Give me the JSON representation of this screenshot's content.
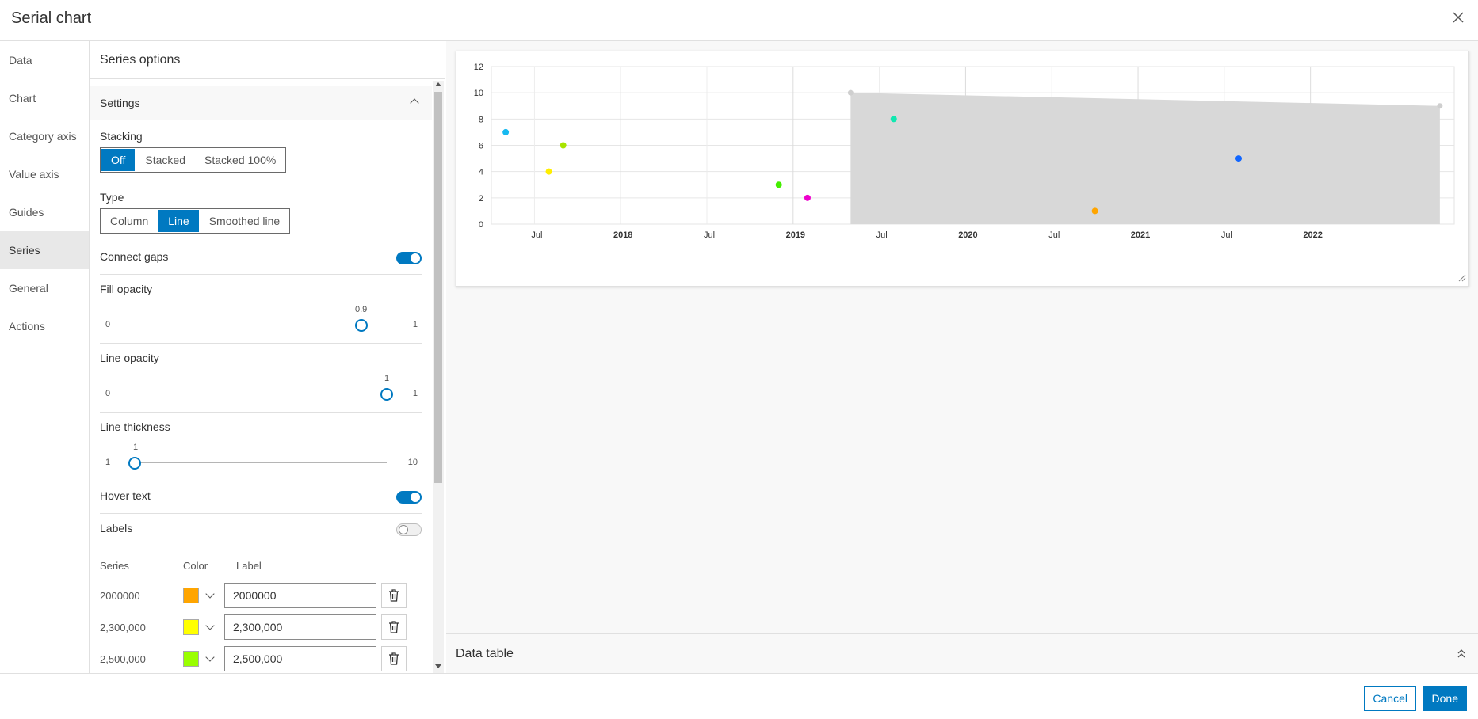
{
  "window": {
    "title": "Serial chart"
  },
  "nav": [
    {
      "label": "Data"
    },
    {
      "label": "Chart"
    },
    {
      "label": "Category axis"
    },
    {
      "label": "Value axis"
    },
    {
      "label": "Guides"
    },
    {
      "label": "Series",
      "active": true
    },
    {
      "label": "General"
    },
    {
      "label": "Actions"
    }
  ],
  "panel": {
    "title": "Series options",
    "settings": {
      "heading": "Settings",
      "stacking": {
        "label": "Stacking",
        "options": [
          "Off",
          "Stacked",
          "Stacked 100%"
        ],
        "selected": "Off"
      },
      "type": {
        "label": "Type",
        "options": [
          "Column",
          "Line",
          "Smoothed line"
        ],
        "selected": "Line"
      },
      "connect_gaps": {
        "label": "Connect gaps",
        "on": true
      },
      "fill_opacity": {
        "label": "Fill opacity",
        "min": "0",
        "max": "1",
        "value": "0.9",
        "fraction": 0.9
      },
      "line_opacity": {
        "label": "Line opacity",
        "min": "0",
        "max": "1",
        "value": "1",
        "fraction": 1.0
      },
      "line_thickness": {
        "label": "Line thickness",
        "min": "1",
        "max": "10",
        "value": "1",
        "fraction": 0.0
      },
      "hover_text": {
        "label": "Hover text",
        "on": true
      },
      "labels": {
        "label": "Labels",
        "on": false
      }
    },
    "series_table": {
      "headers": {
        "series": "Series",
        "color": "Color",
        "label": "Label"
      },
      "rows": [
        {
          "series": "2000000",
          "color": "#ffa500",
          "label": "2000000"
        },
        {
          "series": "2,300,000",
          "color": "#ffff00",
          "label": "2,300,000"
        },
        {
          "series": "2,500,000",
          "color": "#9aff00",
          "label": "2,500,000"
        }
      ]
    }
  },
  "preview": {
    "data_table_label": "Data table"
  },
  "footer": {
    "cancel": "Cancel",
    "done": "Done"
  },
  "chart_data": {
    "type": "scatter",
    "y_ticks": [
      "0",
      "2",
      "4",
      "6",
      "8",
      "10",
      "12"
    ],
    "ylim": [
      0,
      12
    ],
    "x_range": [
      "2017-04",
      "2022-11"
    ],
    "x_ticks": [
      {
        "label": "Jul",
        "date": "2017-07",
        "bold": false
      },
      {
        "label": "2018",
        "date": "2018-01",
        "bold": true
      },
      {
        "label": "Jul",
        "date": "2018-07",
        "bold": false
      },
      {
        "label": "2019",
        "date": "2019-01",
        "bold": true
      },
      {
        "label": "Jul",
        "date": "2019-07",
        "bold": false
      },
      {
        "label": "2020",
        "date": "2020-01",
        "bold": true
      },
      {
        "label": "Jul",
        "date": "2020-07",
        "bold": false
      },
      {
        "label": "2021",
        "date": "2021-01",
        "bold": true
      },
      {
        "label": "Jul",
        "date": "2021-07",
        "bold": false
      },
      {
        "label": "2022",
        "date": "2022-01",
        "bold": true
      }
    ],
    "grid": true,
    "points": [
      {
        "date": "2017-05",
        "y": 7,
        "color": "#17b9f0"
      },
      {
        "date": "2017-08",
        "y": 4,
        "color": "#ffee00"
      },
      {
        "date": "2017-09",
        "y": 6,
        "color": "#a8e400"
      },
      {
        "date": "2018-12",
        "y": 3,
        "color": "#44ee00"
      },
      {
        "date": "2019-02",
        "y": 2,
        "color": "#ee00cc"
      },
      {
        "date": "2019-08",
        "y": 8,
        "color": "#11e8b0"
      },
      {
        "date": "2020-10",
        "y": 1,
        "color": "#ffa500"
      },
      {
        "date": "2021-08",
        "y": 5,
        "color": "#1166ff"
      }
    ],
    "area_series": {
      "color": "#d8d8d8",
      "start": {
        "date": "2019-05",
        "y": 10
      },
      "end": {
        "date": "2022-10",
        "y": 9
      }
    }
  }
}
